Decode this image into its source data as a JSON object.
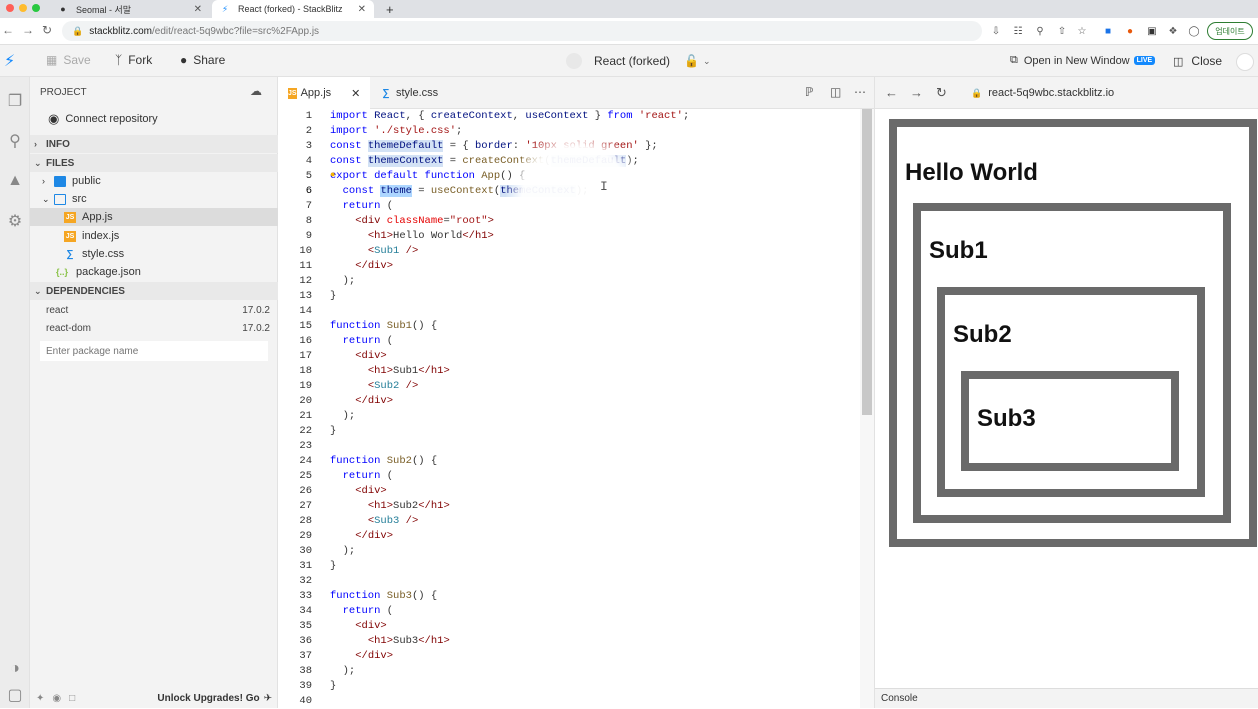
{
  "browser": {
    "tabs": [
      {
        "title": "Seomal - 서말"
      },
      {
        "title": "React (forked) - StackBlitz"
      }
    ],
    "url_host": "stackblitz.com",
    "url_path": "/edit/react-5q9wbc?file=src%2FApp.js",
    "update_label": "업데이트"
  },
  "toolbar": {
    "save_label": "Save",
    "fork_label": "Fork",
    "share_label": "Share",
    "project_title": "React (forked)",
    "open_new_label": "Open in New Window",
    "live_label": "LIVE",
    "close_label": "Close"
  },
  "sidebar": {
    "project_label": "PROJECT",
    "connect_repo_label": "Connect repository",
    "info_label": "INFO",
    "files_label": "FILES",
    "files": {
      "public": "public",
      "src": "src",
      "app": "App.js",
      "index": "index.js",
      "style": "style.css",
      "package": "package.json"
    },
    "dependencies_label": "DEPENDENCIES",
    "dependencies": [
      {
        "name": "react",
        "version": "17.0.2"
      },
      {
        "name": "react-dom",
        "version": "17.0.2"
      }
    ],
    "package_placeholder": "Enter package name",
    "unlock_label": "Unlock Upgrades! Go"
  },
  "editor": {
    "tabs": [
      {
        "label": "App.js"
      },
      {
        "label": "style.css"
      }
    ],
    "line_numbers": [
      "1",
      "2",
      "3",
      "4",
      "5",
      "6",
      "7",
      "8",
      "9",
      "10",
      "11",
      "12",
      "13",
      "14",
      "15",
      "16",
      "17",
      "18",
      "19",
      "20",
      "21",
      "22",
      "23",
      "24",
      "25",
      "26",
      "27",
      "28",
      "29",
      "30",
      "31",
      "32",
      "33",
      "34",
      "35",
      "36",
      "37",
      "38",
      "39",
      "40"
    ]
  },
  "preview": {
    "url": "react-5q9wbc.stackblitz.io",
    "h_hello": "Hello World",
    "h_sub1": "Sub1",
    "h_sub2": "Sub2",
    "h_sub3": "Sub3",
    "console_label": "Console"
  },
  "colors": {
    "accent": "#1389fd",
    "border_gray": "#6a6a6a"
  }
}
